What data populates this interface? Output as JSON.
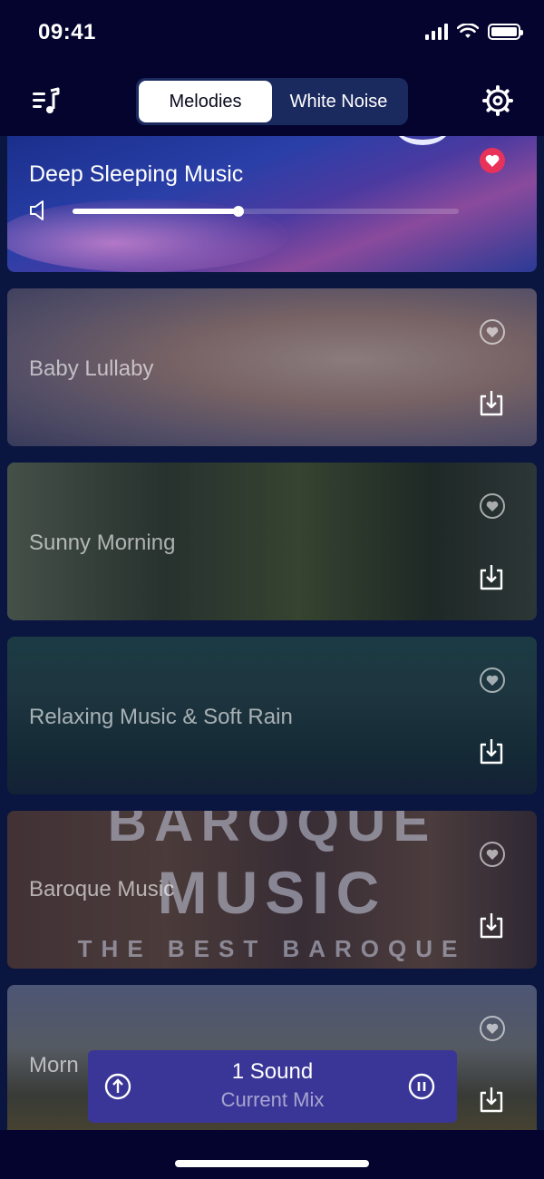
{
  "status_bar": {
    "time": "09:41"
  },
  "header": {
    "tabs": [
      {
        "label": "Melodies",
        "active": true
      },
      {
        "label": "White Noise",
        "active": false
      }
    ]
  },
  "now_playing": {
    "title": "Deep Sleeping Music",
    "volume": 0.43,
    "favorite": true,
    "favorite_color": "#e8325a"
  },
  "tracks": [
    {
      "title": "Baby Lullaby"
    },
    {
      "title": "Sunny Morning"
    },
    {
      "title": "Relaxing Music & Soft Rain"
    },
    {
      "title": "Baroque Music",
      "artwork_text": [
        "BAROQUE",
        "MUSIC",
        "THE BEST BAROQUE"
      ]
    },
    {
      "title": "Morn"
    }
  ],
  "player": {
    "count": "1 Sound",
    "subtitle": "Current Mix",
    "background": "#3a3697"
  }
}
